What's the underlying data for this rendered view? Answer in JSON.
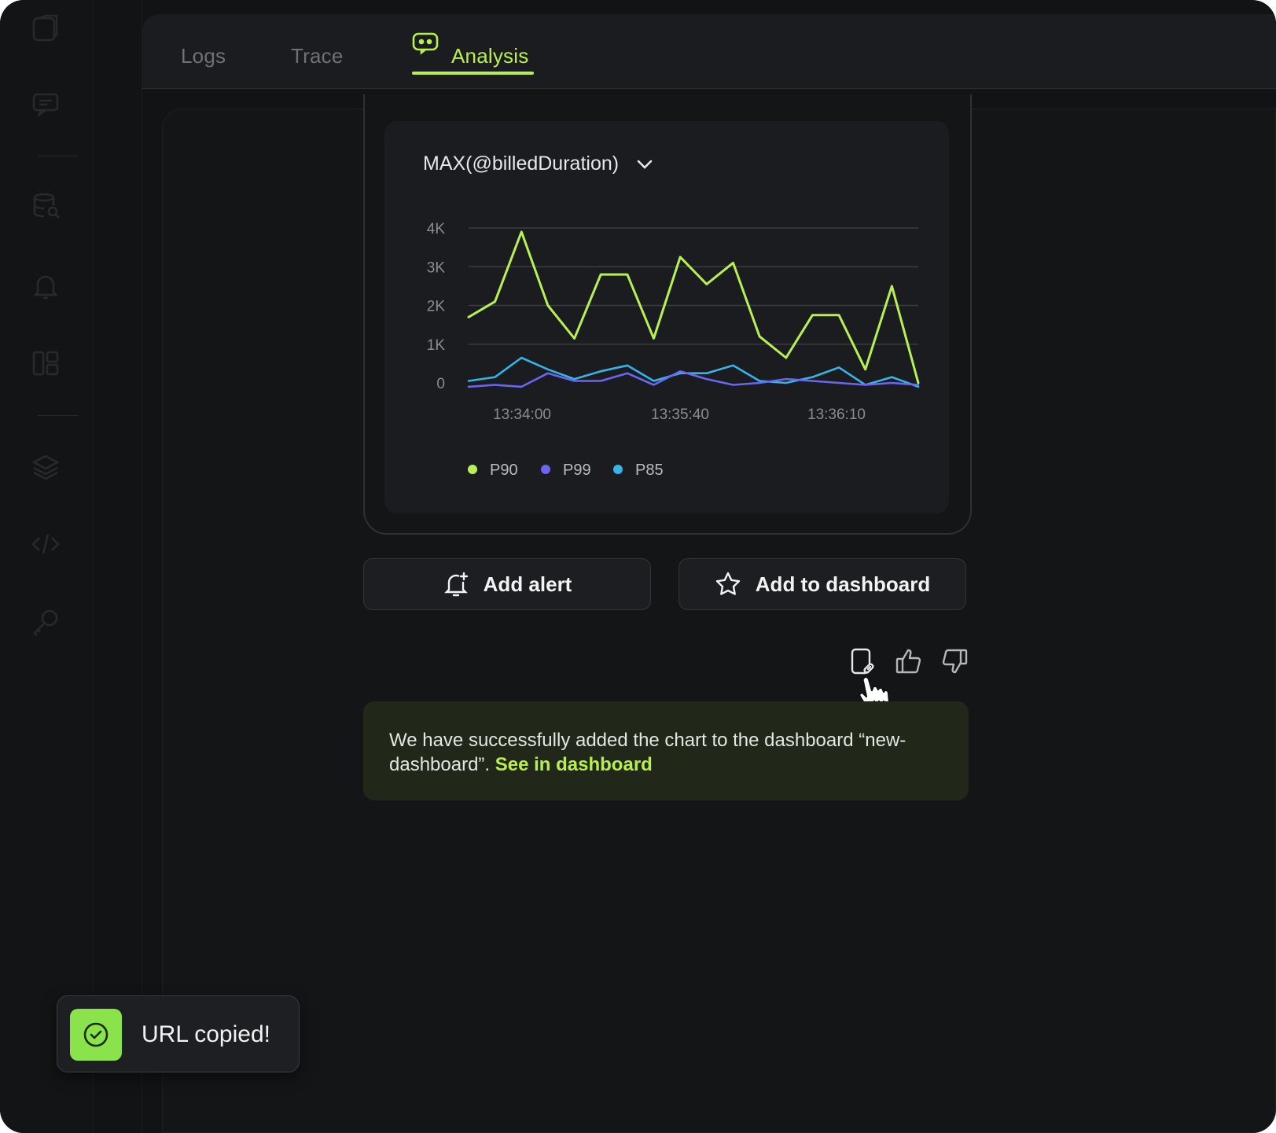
{
  "tabs": [
    {
      "label": "Logs",
      "active": false
    },
    {
      "label": "Trace",
      "active": false
    },
    {
      "label": "Analysis",
      "active": true
    }
  ],
  "chart_title": "MAX(@billedDuration)",
  "chart_data": {
    "type": "line",
    "title": "MAX(@billedDuration)",
    "xlabel": "",
    "ylabel": "",
    "ylim": [
      0,
      4000
    ],
    "y_ticks": [
      "4K",
      "3K",
      "2K",
      "1K",
      "0"
    ],
    "x_tick_labels": [
      "13:34:00",
      "13:35:40",
      "13:36:10"
    ],
    "grid": true,
    "legend_position": "bottom-left",
    "series": [
      {
        "name": "P90",
        "color": "#b8f054",
        "values": [
          1700,
          2100,
          3900,
          2000,
          1150,
          2800,
          2800,
          1150,
          3250,
          2550,
          3100,
          1200,
          650,
          1750,
          1750,
          350,
          2500,
          0
        ]
      },
      {
        "name": "P99",
        "color": "#6b66f0",
        "values": [
          -100,
          -50,
          -100,
          250,
          50,
          50,
          250,
          -50,
          300,
          100,
          -50,
          0,
          100,
          50,
          0,
          -50,
          0,
          -50
        ]
      },
      {
        "name": "P85",
        "color": "#36b3e8",
        "values": [
          50,
          150,
          650,
          350,
          100,
          300,
          450,
          50,
          250,
          250,
          450,
          50,
          0,
          150,
          400,
          -50,
          150,
          -100
        ]
      }
    ]
  },
  "buttons": {
    "add_alert": "Add alert",
    "add_to_dashboard": "Add to dashboard"
  },
  "success": {
    "text": "We have successfully added the chart to the dashboard “new-dashboard”. ",
    "link": "See in dashboard"
  },
  "toast": {
    "text": "URL copied!"
  }
}
